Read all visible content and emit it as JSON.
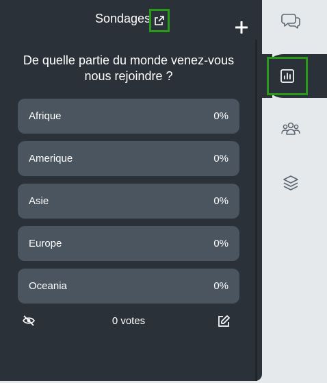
{
  "header": {
    "title": "Sondages"
  },
  "poll": {
    "question": "De quelle partie du monde venez-vous nous rejoindre ?",
    "options": [
      {
        "label": "Afrique",
        "percent": "0%"
      },
      {
        "label": "Amerique",
        "percent": "0%"
      },
      {
        "label": "Asie",
        "percent": "0%"
      },
      {
        "label": "Europe",
        "percent": "0%"
      },
      {
        "label": "Oceania",
        "percent": "0%"
      }
    ],
    "votes": "0 votes"
  },
  "icons": {
    "popout": "external-link-icon",
    "add": "plus-icon",
    "hide_results": "eye-slash-icon",
    "edit": "edit-icon",
    "rail": [
      "chat-bubbles-icon",
      "poll-chart-icon",
      "users-group-icon",
      "layers-icon"
    ]
  },
  "colors": {
    "panel": "#2b3138",
    "option": "#4a5560",
    "rail": "#e6e9ec",
    "highlight": "#2a9a1a"
  }
}
